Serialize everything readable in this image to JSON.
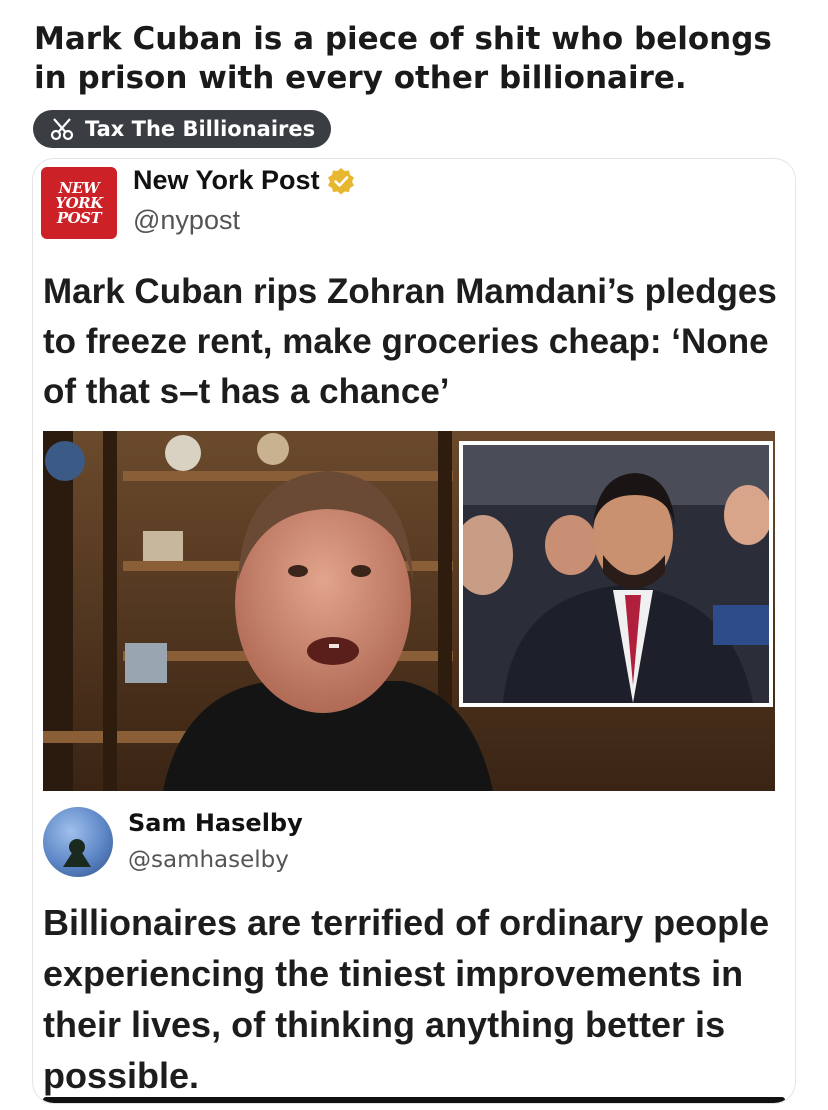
{
  "post": {
    "title": "Mark Cuban is a piece of shit who belongs in prison with every other billionaire.",
    "flair": "Tax The Billionaires",
    "flair_icon": "scissors-icon"
  },
  "embedded_post": {
    "account_name": "New York Post",
    "account_handle": "@nypost",
    "logo_text": [
      "NEW",
      "YORK",
      "POST"
    ],
    "verified_icon": "verified-badge-icon",
    "headline": "Mark Cuban rips Zohran Mamdani’s pledges to freeze rent, make groceries cheap: ‘None of that s–t has a chance’",
    "image_icon": "news-photo"
  },
  "quoted_post": {
    "account_name": "Sam Haselby",
    "account_handle": "@samhaselby",
    "text": "Billionaires are terrified of ordinary people experiencing the tiniest improvements in their lives, of thinking anything better is possible."
  },
  "colors": {
    "flair_bg": "#3a3d42",
    "nyp_red": "#cc2127",
    "verified_gold": "#e8b730"
  }
}
